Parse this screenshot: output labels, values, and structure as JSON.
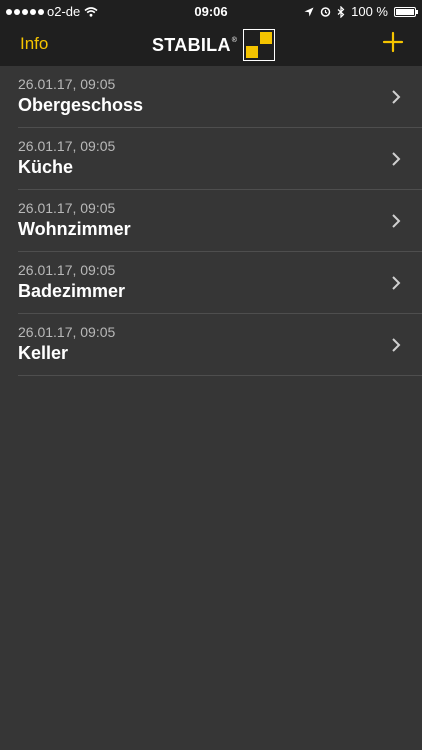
{
  "status": {
    "carrier": "o2-de",
    "time": "09:06",
    "battery": "100 %"
  },
  "nav": {
    "left_label": "Info",
    "logo": "STABILA",
    "logo_reg": "®",
    "add_icon": "plus-icon"
  },
  "colors": {
    "accent": "#f5c400",
    "background": "#363636",
    "bar": "#1f1f1f"
  },
  "rows": [
    {
      "date": "26.01.17, 09:05",
      "title": "Obergeschoss"
    },
    {
      "date": "26.01.17, 09:05",
      "title": "Küche"
    },
    {
      "date": "26.01.17, 09:05",
      "title": "Wohnzimmer"
    },
    {
      "date": "26.01.17, 09:05",
      "title": "Badezimmer"
    },
    {
      "date": "26.01.17, 09:05",
      "title": "Keller"
    }
  ]
}
